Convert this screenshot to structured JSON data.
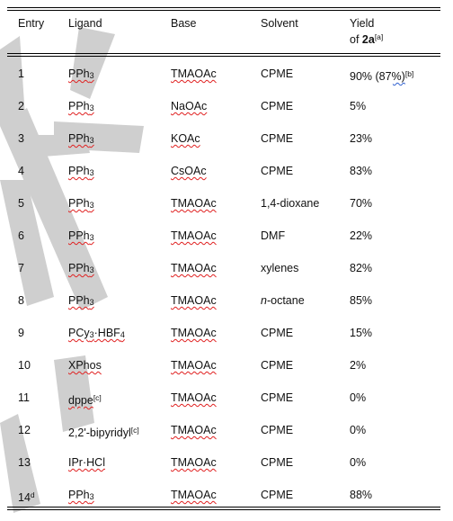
{
  "header": {
    "entry": "Entry",
    "ligand": "Ligand",
    "base": "Base",
    "solvent": "Solvent",
    "yield_line1": "Yield",
    "yield_of": "of ",
    "yield_compound": "2a",
    "yield_note": "[a]"
  },
  "rows": [
    {
      "entry": "1",
      "entry_note": "",
      "ligand": [
        [
          "PPh",
          ""
        ],
        [
          "3",
          "sub"
        ]
      ],
      "ligand_note": "",
      "base": "TMAOAc",
      "solvent": [
        [
          "CPME",
          ""
        ]
      ],
      "yield": "90% (87%)",
      "yield_note": "[b]"
    },
    {
      "entry": "2",
      "entry_note": "",
      "ligand": [
        [
          "PPh",
          ""
        ],
        [
          "3",
          "sub"
        ]
      ],
      "ligand_note": "",
      "base": "NaOAc",
      "solvent": [
        [
          "CPME",
          ""
        ]
      ],
      "yield": "5%",
      "yield_note": ""
    },
    {
      "entry": "3",
      "entry_note": "",
      "ligand": [
        [
          "PPh",
          ""
        ],
        [
          "3",
          "sub"
        ]
      ],
      "ligand_note": "",
      "base": "KOAc",
      "solvent": [
        [
          "CPME",
          ""
        ]
      ],
      "yield": "23%",
      "yield_note": ""
    },
    {
      "entry": "4",
      "entry_note": "",
      "ligand": [
        [
          "PPh",
          ""
        ],
        [
          "3",
          "sub"
        ]
      ],
      "ligand_note": "",
      "base": "CsOAc",
      "solvent": [
        [
          "CPME",
          ""
        ]
      ],
      "yield": "83%",
      "yield_note": ""
    },
    {
      "entry": "5",
      "entry_note": "",
      "ligand": [
        [
          "PPh",
          ""
        ],
        [
          "3",
          "sub"
        ]
      ],
      "ligand_note": "",
      "base": "TMAOAc",
      "solvent": [
        [
          "1,4-dioxane",
          ""
        ]
      ],
      "yield": "70%",
      "yield_note": ""
    },
    {
      "entry": "6",
      "entry_note": "",
      "ligand": [
        [
          "PPh",
          ""
        ],
        [
          "3",
          "sub"
        ]
      ],
      "ligand_note": "",
      "base": "TMAOAc",
      "solvent": [
        [
          "DMF",
          ""
        ]
      ],
      "yield": "22%",
      "yield_note": ""
    },
    {
      "entry": "7",
      "entry_note": "",
      "ligand": [
        [
          "PPh",
          ""
        ],
        [
          "3",
          "sub"
        ]
      ],
      "ligand_note": "",
      "base": "TMAOAc",
      "solvent": [
        [
          "xylenes",
          ""
        ]
      ],
      "yield": "82%",
      "yield_note": ""
    },
    {
      "entry": "8",
      "entry_note": "",
      "ligand": [
        [
          "PPh",
          ""
        ],
        [
          "3",
          "sub"
        ]
      ],
      "ligand_note": "",
      "base": "TMAOAc",
      "solvent": [
        [
          "n",
          "i"
        ],
        [
          "-octane",
          ""
        ]
      ],
      "yield": "85%",
      "yield_note": ""
    },
    {
      "entry": "9",
      "entry_note": "",
      "ligand": [
        [
          "PCy",
          ""
        ],
        [
          "3",
          "sub"
        ],
        [
          "·HBF",
          ""
        ],
        [
          "4",
          "sub"
        ]
      ],
      "ligand_note": "",
      "base": "TMAOAc",
      "solvent": [
        [
          "CPME",
          ""
        ]
      ],
      "yield": "15%",
      "yield_note": ""
    },
    {
      "entry": "10",
      "entry_note": "",
      "ligand": [
        [
          "XPhos",
          ""
        ]
      ],
      "ligand_note": "",
      "base": "TMAOAc",
      "solvent": [
        [
          "CPME",
          ""
        ]
      ],
      "yield": "2%",
      "yield_note": ""
    },
    {
      "entry": "11",
      "entry_note": "",
      "ligand": [
        [
          "dppe",
          ""
        ]
      ],
      "ligand_note": "[c]",
      "base": "TMAOAc",
      "solvent": [
        [
          "CPME",
          ""
        ]
      ],
      "yield": "0%",
      "yield_note": ""
    },
    {
      "entry": "12",
      "entry_note": "",
      "ligand": [
        [
          "2,2'-bipyridyl",
          ""
        ]
      ],
      "ligand_note": "[c]",
      "base": "TMAOAc",
      "solvent": [
        [
          "CPME",
          ""
        ]
      ],
      "yield": "0%",
      "yield_note": "",
      "ligand_plain": true
    },
    {
      "entry": "13",
      "entry_note": "",
      "ligand": [
        [
          "IPr·HCl",
          ""
        ]
      ],
      "ligand_note": "",
      "base": "TMAOAc",
      "solvent": [
        [
          "CPME",
          ""
        ]
      ],
      "yield": "0%",
      "yield_note": ""
    },
    {
      "entry": "14",
      "entry_note": "d",
      "ligand": [
        [
          "PPh",
          ""
        ],
        [
          "3",
          "sub"
        ]
      ],
      "ligand_note": "",
      "base": "TMAOAc",
      "solvent": [
        [
          "CPME",
          ""
        ]
      ],
      "yield": "88%",
      "yield_note": ""
    }
  ],
  "colors": {
    "watermark": "#c8c8c8",
    "spellcheck": "#e02020",
    "link": "#3060d0"
  }
}
